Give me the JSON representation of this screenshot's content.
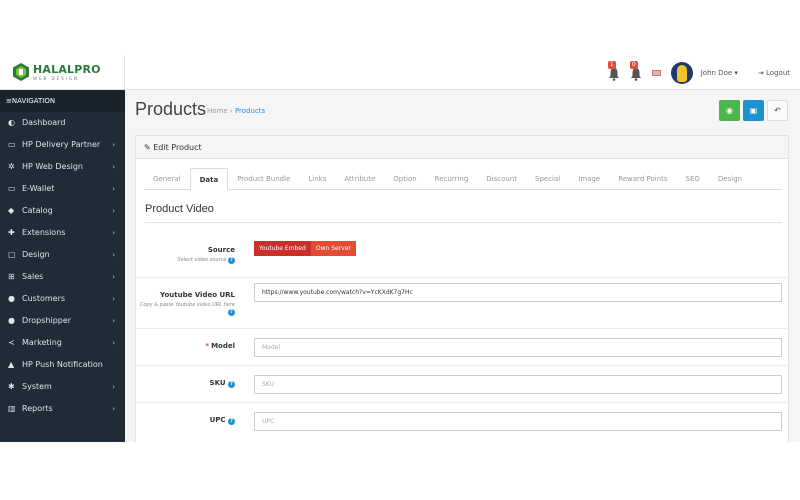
{
  "header": {
    "logo_text": "HALALPRO",
    "logo_sub": "WEB DESIGN",
    "notif1_count": "1",
    "notif2_count": "0",
    "user_name": "John Doe",
    "logout_label": "Logout"
  },
  "sidebar": {
    "title": "NAVIGATION",
    "items": [
      {
        "label": "Dashboard",
        "icon": "dashboard-icon",
        "has_children": false
      },
      {
        "label": "HP Delivery Partner",
        "icon": "card-icon",
        "has_children": true
      },
      {
        "label": "HP Web Design",
        "icon": "cogs-icon",
        "has_children": true
      },
      {
        "label": "E-Wallet",
        "icon": "wallet-icon",
        "has_children": true
      },
      {
        "label": "Catalog",
        "icon": "tag-icon",
        "has_children": true
      },
      {
        "label": "Extensions",
        "icon": "puzzle-icon",
        "has_children": true
      },
      {
        "label": "Design",
        "icon": "monitor-icon",
        "has_children": true
      },
      {
        "label": "Sales",
        "icon": "cart-icon",
        "has_children": true
      },
      {
        "label": "Customers",
        "icon": "user-icon",
        "has_children": true
      },
      {
        "label": "Dropshipper",
        "icon": "users-icon",
        "has_children": true
      },
      {
        "label": "Marketing",
        "icon": "share-icon",
        "has_children": true
      },
      {
        "label": "HP Push Notification",
        "icon": "bell-icon",
        "has_children": false
      },
      {
        "label": "System",
        "icon": "gear-icon",
        "has_children": true
      },
      {
        "label": "Reports",
        "icon": "chart-icon",
        "has_children": true
      }
    ]
  },
  "page": {
    "title": "Products",
    "breadcrumb_home": "Home",
    "breadcrumb_sep": "›",
    "breadcrumb_current": "Products"
  },
  "panel": {
    "heading": "Edit Product",
    "tabs": [
      "General",
      "Data",
      "Product Bundle",
      "Links",
      "Attribute",
      "Option",
      "Recurring",
      "Discount",
      "Special",
      "Image",
      "Reward Points",
      "SEO",
      "Design"
    ],
    "active_tab": "Data",
    "section_title": "Product Video"
  },
  "form": {
    "source": {
      "label": "Source",
      "help": "Select video source",
      "option_youtube": "Youtube Embed",
      "option_own": "Own Server"
    },
    "youtube_url": {
      "label": "Youtube Video URL",
      "help": "Copy & paste Youtube video URL here",
      "value": "https://www.youtube.com/watch?v=YcKXdK7g7Hc"
    },
    "model": {
      "label": "Model",
      "required_mark": "*",
      "placeholder": "Model"
    },
    "sku": {
      "label": "SKU",
      "placeholder": "SKU"
    },
    "upc": {
      "label": "UPC",
      "placeholder": "UPC"
    }
  }
}
